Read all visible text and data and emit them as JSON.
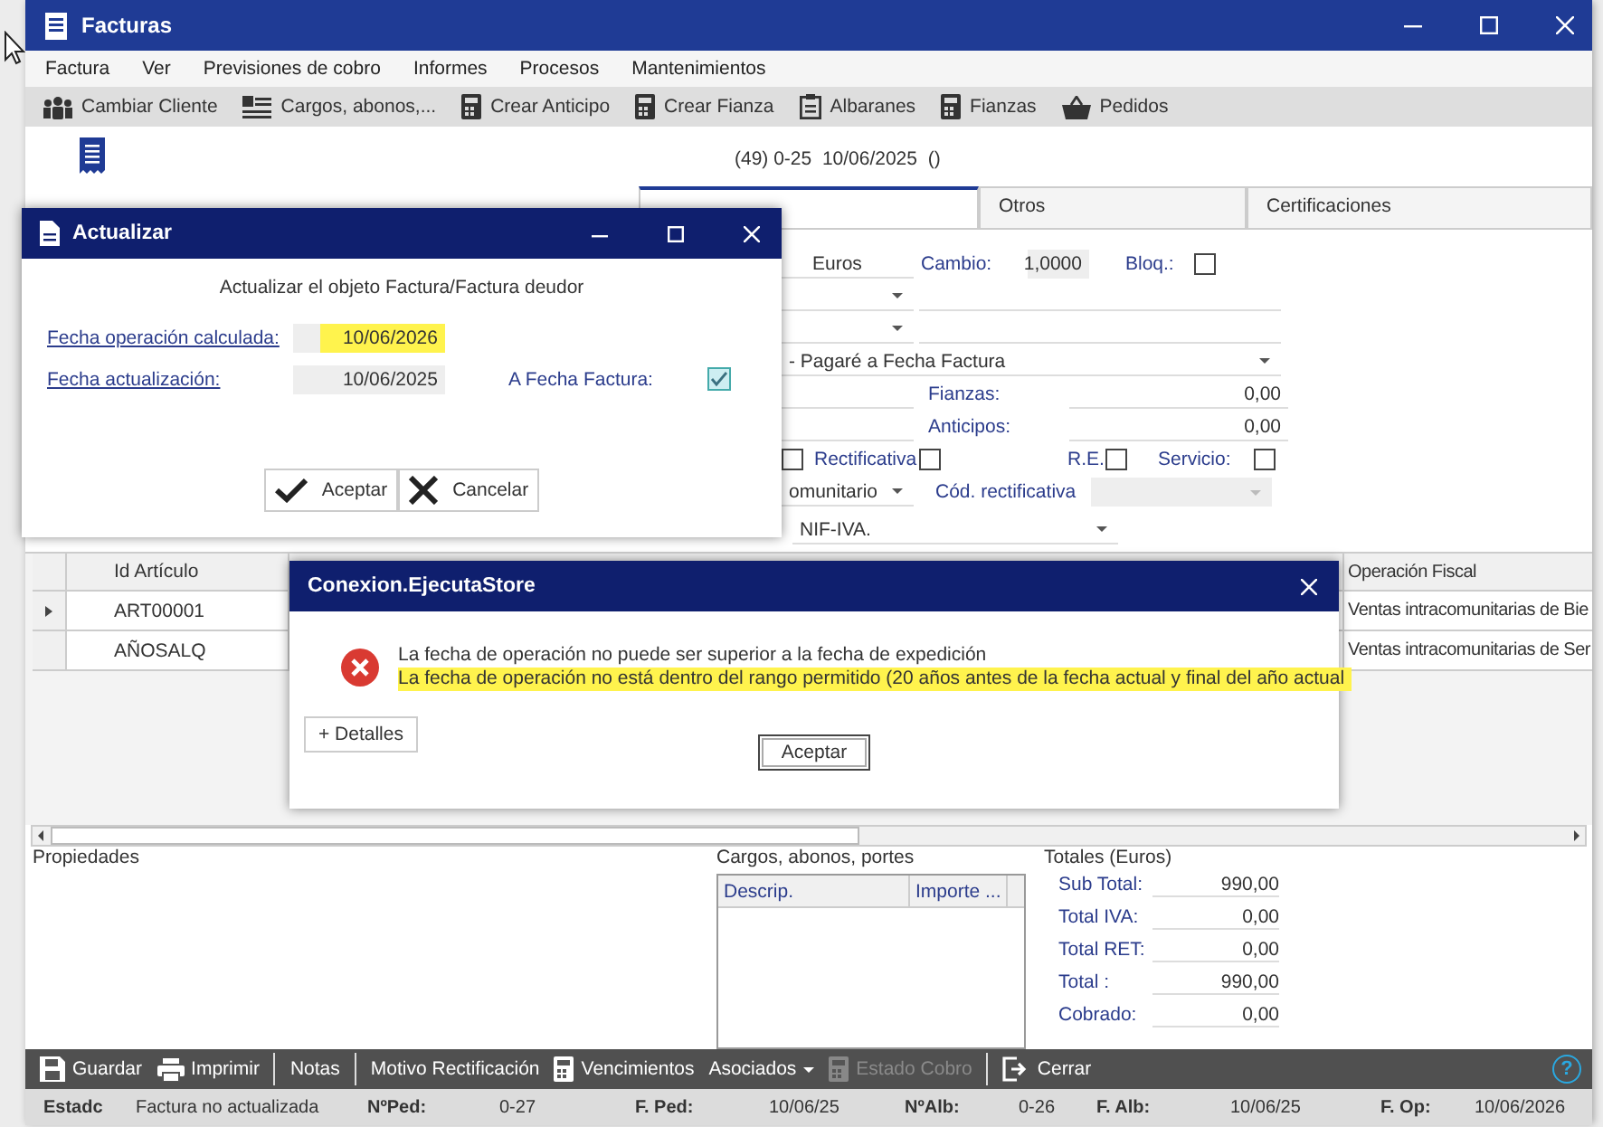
{
  "window": {
    "title": "Facturas"
  },
  "menu": [
    "Factura",
    "Ver",
    "Previsiones de cobro",
    "Informes",
    "Procesos",
    "Mantenimientos"
  ],
  "toolbar": [
    "Cambiar Cliente",
    "Cargos, abonos,...",
    "Crear Anticipo",
    "Crear Fianza",
    "Albaranes",
    "Fianzas",
    "Pedidos"
  ],
  "header": "(49) 0-25  10/06/2025  ()",
  "tabs": [
    {
      "selected": true
    },
    {
      "label": "Otros",
      "selected": false
    },
    {
      "label": "Certificaciones",
      "selected": false
    }
  ],
  "form": {
    "currency": "Euros",
    "exchange_label": "Cambio:",
    "exchange_value": "1,0000",
    "lock_label": "Bloq.:",
    "locked": false,
    "payment": "- Pagaré a Fecha Factura",
    "bonds_label": "Fianzas:",
    "bonds_value": "0,00",
    "advances_label": "Anticipos:",
    "advances_value": "0,00",
    "flag_checked": false,
    "corrective_label": "Rectificativa",
    "corrective": false,
    "re_label": "R.E.",
    "re": false,
    "service_label": "Servicio:",
    "service": false,
    "operation_type": "omunitario",
    "corrective_code_label": "Cód. rectificativa",
    "tax_id_type": "NIF-IVA."
  },
  "grid": {
    "columns": [
      "Id Artículo",
      "Operación Fiscal"
    ],
    "rows": [
      {
        "id": "ART00001",
        "operation": "Ventas intracomunitarias de Bie",
        "current": true
      },
      {
        "id": "AÑOSALQ",
        "operation": "Ventas intracomunitarias de Ser",
        "current": false
      }
    ]
  },
  "properties": {
    "title": "Propiedades"
  },
  "charges": {
    "title": "Cargos, abonos, portes",
    "columns": [
      "Descrip.",
      "Importe ..."
    ]
  },
  "totals": {
    "title": "Totales (Euros)",
    "rows": [
      {
        "label": "Sub Total:",
        "value": "990,00"
      },
      {
        "label": "Total IVA:",
        "value": "0,00"
      },
      {
        "label": "Total RET:",
        "value": "0,00"
      },
      {
        "label": "Total :",
        "value": "990,00"
      },
      {
        "label": "Cobrado:",
        "value": "0,00"
      }
    ]
  },
  "bottom_toolbar": [
    {
      "label": "Guardar",
      "kind": "button",
      "disabled": false
    },
    {
      "label": "Imprimir",
      "kind": "button",
      "disabled": false
    },
    {
      "label": "Notas",
      "kind": "button",
      "disabled": false
    },
    {
      "label": "Motivo Rectificación",
      "kind": "button",
      "disabled": false
    },
    {
      "label": "Vencimientos",
      "kind": "button",
      "disabled": false
    },
    {
      "label": "Asociados",
      "kind": "dropdown",
      "disabled": false
    },
    {
      "label": "Estado Cobro",
      "kind": "button",
      "disabled": true
    },
    {
      "label": "Cerrar",
      "kind": "button",
      "disabled": false
    }
  ],
  "help": "?",
  "status_bar": [
    {
      "label": "Estadc",
      "value": "Factura no actualizada"
    },
    {
      "label": "NºPed:",
      "value": "0-27"
    },
    {
      "label": "F. Ped:",
      "value": "10/06/25"
    },
    {
      "label": "NºAlb:",
      "value": "0-26"
    },
    {
      "label": "F. Alb:",
      "value": "10/06/25"
    },
    {
      "label": "F. Op:",
      "value": "10/06/2026"
    }
  ],
  "update_dialog": {
    "title": "Actualizar",
    "message": "Actualizar el objeto Factura/Factura deudor",
    "fields": [
      {
        "label": "Fecha operación calculada:",
        "value": "10/06/2026",
        "highlighted": true
      },
      {
        "label": "Fecha actualización:",
        "value": "10/06/2025",
        "highlighted": false
      }
    ],
    "checkbox": {
      "label": "A Fecha Factura:",
      "checked": true
    },
    "buttons": [
      "Aceptar",
      "Cancelar"
    ]
  },
  "error_dialog": {
    "title": "Conexion.EjecutaStore",
    "messages": [
      {
        "text": "La fecha de operación no puede ser superior a la fecha de expedición",
        "highlighted": false
      },
      {
        "text": "La fecha de operación no está dentro del rango permitido (20 años antes de la fecha actual y final del año actual",
        "highlighted": true
      }
    ],
    "details_button": "+ Detalles",
    "ok_button": "Aceptar"
  }
}
